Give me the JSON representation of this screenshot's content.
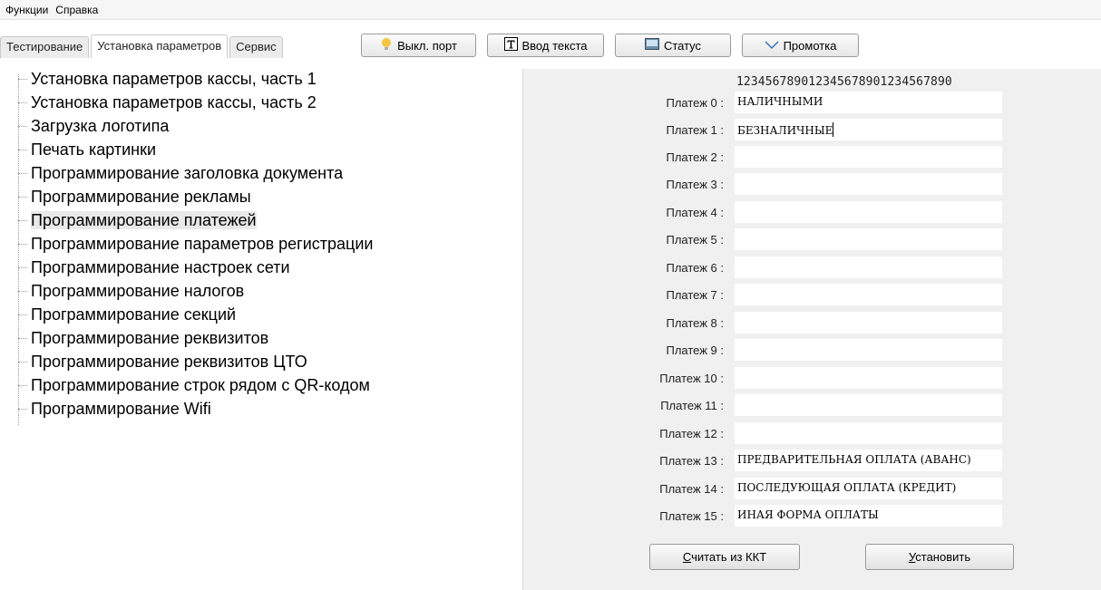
{
  "menu": {
    "items": [
      "Функции",
      "Справка"
    ]
  },
  "tabs": [
    {
      "label": "Тестирование",
      "active": false
    },
    {
      "label": "Установка параметров",
      "active": true
    },
    {
      "label": "Сервис",
      "active": false
    }
  ],
  "toolbar": {
    "port_label": "Выкл. порт",
    "text_input_label": "Ввод текста",
    "status_label": "Статус",
    "scroll_label": "Промотка",
    "port_icon": "lightbulb-icon",
    "text_icon": "text-t-icon",
    "status_icon": "monitor-icon",
    "scroll_icon": "chevron-down-icon"
  },
  "tree": {
    "items": [
      "Установка параметров кассы, часть 1",
      "Установка параметров кассы, часть 2",
      "Загрузка логотипа",
      "Печать картинки",
      "Программирование заголовка документа",
      "Программирование рекламы",
      "Программирование платежей",
      "Программирование параметров регистрации",
      "Программирование настроек сети",
      "Программирование налогов",
      "Программирование секций",
      "Программирование реквизитов",
      "Программирование реквизитов ЦТО",
      "Программирование строк рядом с QR-кодом",
      "Программирование Wifi"
    ],
    "selected": "Программирование платежей"
  },
  "payments": {
    "ruler": "123456789012345678901234567890",
    "rows": [
      {
        "label": "Платеж 0 :",
        "value": "НАЛИЧНЫМИ"
      },
      {
        "label": "Платеж 1 :",
        "value": "БЕЗНАЛИЧНЫЕ"
      },
      {
        "label": "Платеж 2 :",
        "value": ""
      },
      {
        "label": "Платеж 3 :",
        "value": ""
      },
      {
        "label": "Платеж 4 :",
        "value": ""
      },
      {
        "label": "Платеж 5 :",
        "value": ""
      },
      {
        "label": "Платеж 6 :",
        "value": ""
      },
      {
        "label": "Платеж 7 :",
        "value": ""
      },
      {
        "label": "Платеж 8 :",
        "value": ""
      },
      {
        "label": "Платеж 9 :",
        "value": ""
      },
      {
        "label": "Платеж 10 :",
        "value": ""
      },
      {
        "label": "Платеж 11 :",
        "value": ""
      },
      {
        "label": "Платеж 12 :",
        "value": ""
      },
      {
        "label": "Платеж 13 :",
        "value": "ПРЕДВАРИТЕЛЬНАЯ ОПЛАТА (АВАНС)"
      },
      {
        "label": "Платеж 14 :",
        "value": "ПОСЛЕДУЮЩАЯ ОПЛАТА (КРЕДИТ)"
      },
      {
        "label": "Платеж 15 :",
        "value": "ИНАЯ ФОРМА ОПЛАТЫ"
      }
    ],
    "read_button": "Считать из ККТ",
    "set_button": "Установить"
  }
}
